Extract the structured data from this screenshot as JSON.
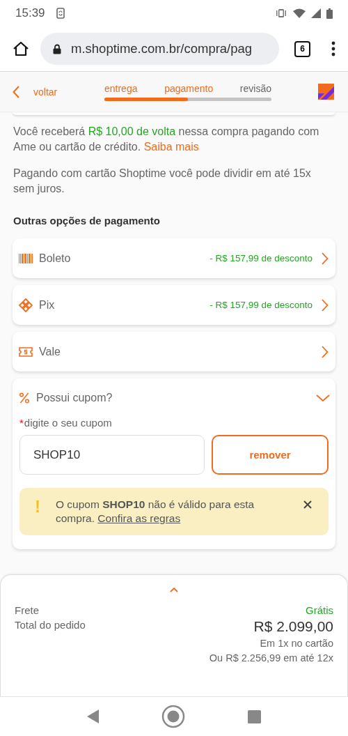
{
  "status_bar": {
    "time": "15:39"
  },
  "browser": {
    "url": "m.shoptime.com.br/compra/pag",
    "tab_count": "6"
  },
  "header": {
    "back_label": "voltar",
    "steps": [
      {
        "label": "entrega",
        "active": true
      },
      {
        "label": "pagamento",
        "active": true
      },
      {
        "label": "revisão",
        "active": false
      }
    ],
    "progress": {
      "level": 0.5
    }
  },
  "cashback": {
    "parts": [
      {
        "kind": "plain",
        "text": "Você receberá "
      },
      {
        "kind": "highlight",
        "text": "R$ 10,00 de volta"
      },
      {
        "kind": "plain",
        "text": " nessa compra pagando com Ame ou cartão de crédito. "
      },
      {
        "kind": "link",
        "text": "Saiba mais"
      }
    ]
  },
  "installment_note": "Pagando com cartão Shoptime você pode dividir em até 15x sem juros.",
  "other_options": {
    "title": "Outras opções de pagamento",
    "options": [
      {
        "kind": "barcode",
        "label": "Boleto",
        "discount": "- R$ 157,99 de desconto"
      },
      {
        "kind": "pix",
        "label": "Pix",
        "discount": "- R$ 157,99 de desconto"
      },
      {
        "kind": "voucher",
        "label": "Vale"
      }
    ]
  },
  "coupon": {
    "title": "Possui cupom?",
    "expanded": true,
    "required_mark": "*",
    "field_label": "digite o seu cupom",
    "value": "SHOP10",
    "button": "remover",
    "alert": {
      "mark": "!",
      "text": "O cupom **SHOP10** não é válido para esta compra.",
      "link": "Confira as regras"
    }
  },
  "summary": {
    "expanded": false,
    "rows": [
      {
        "kind": "shipping",
        "label": "Frete",
        "value": "Grátis"
      },
      {
        "kind": "total",
        "label": "Total do pedido",
        "value": "R$ 2.099,00"
      }
    ],
    "notes": [
      "Em 1x no cartão",
      "Ou R$ 2.256,99 em até 12x"
    ]
  }
}
